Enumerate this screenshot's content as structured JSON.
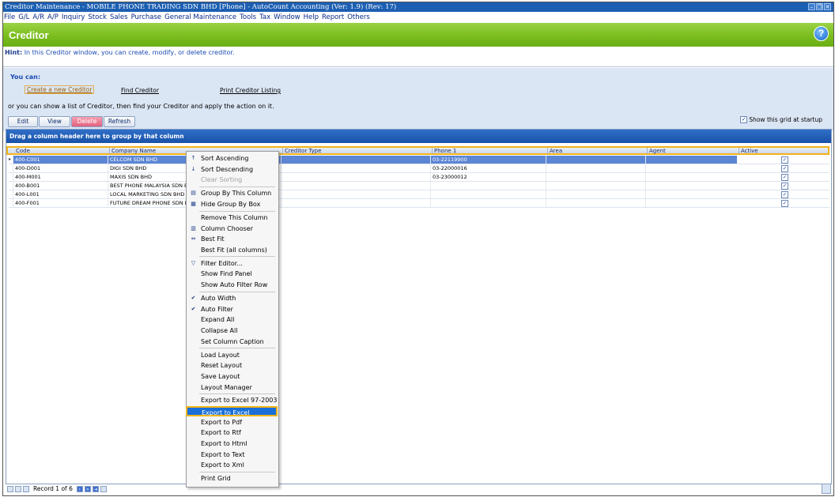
{
  "window": {
    "title": "Creditor Maintenance - MOBILE PHONE TRADING SDN BHD [Phone] - AutoCount Accounting (Ver: 1.9) (Rev: 17)"
  },
  "menu": [
    "File",
    "G/L",
    "A/R",
    "A/P",
    "Inquiry",
    "Stock",
    "Sales",
    "Purchase",
    "General Maintenance",
    "Tools",
    "Tax",
    "Window",
    "Help",
    "Report",
    "Others"
  ],
  "banner": {
    "title": "Creditor"
  },
  "hint": {
    "label": "Hint:",
    "text": " In this Creditor window, you can create, modify, or delete creditor."
  },
  "actions": {
    "you_can": "You can:",
    "links": [
      "Create a new Creditor",
      "Find Creditor",
      "Print Creditor Listing"
    ],
    "or_text": "or you can show a list of Creditor, then find your Creditor and apply the action on it.",
    "buttons": [
      "Edit",
      "View",
      "Delete",
      "Refresh"
    ],
    "show_startup": "Show this grid at startup"
  },
  "grid": {
    "group_panel": "Drag a column header here to group by that column",
    "columns": [
      "Code",
      "Company Name",
      "Creditor Type",
      "Phone 1",
      "Area",
      "Agent",
      "Active"
    ],
    "rows": [
      {
        "code": "400-C001",
        "name": "CELCOM SDN BHD",
        "phone": "03-22119900"
      },
      {
        "code": "400-D001",
        "name": "DIGI SDN BHD",
        "phone": "03-22000016"
      },
      {
        "code": "400-M001",
        "name": "MAXIS SDN BHD",
        "phone": "03-23000012"
      },
      {
        "code": "400-B001",
        "name": "BEST PHONE MALAYSIA SDN BHD",
        "phone": ""
      },
      {
        "code": "400-L001",
        "name": "LOCAL MARKETING SDN BHD",
        "phone": ""
      },
      {
        "code": "400-F001",
        "name": "FUTURE DREAM PHONE SDN BHD",
        "phone": ""
      }
    ],
    "record_text": "Record 1 of 6"
  },
  "context_menu": [
    {
      "label": "Sort Ascending",
      "icon": "sort-asc-icon"
    },
    {
      "label": "Sort Descending",
      "icon": "sort-desc-icon"
    },
    {
      "label": "Clear Sorting",
      "disabled": true
    },
    {
      "sep": true
    },
    {
      "label": "Group By This Column",
      "icon": "group-icon"
    },
    {
      "label": "Hide Group By Box",
      "icon": "group-box-icon"
    },
    {
      "sep": true
    },
    {
      "label": "Remove This Column"
    },
    {
      "label": "Column Chooser",
      "icon": "column-chooser-icon"
    },
    {
      "label": "Best Fit",
      "icon": "best-fit-icon"
    },
    {
      "label": "Best Fit (all columns)"
    },
    {
      "sep": true
    },
    {
      "label": "Filter Editor...",
      "icon": "filter-icon"
    },
    {
      "label": "Show Find Panel"
    },
    {
      "label": "Show Auto Filter Row"
    },
    {
      "sep": true
    },
    {
      "label": "Auto Width",
      "checked": true
    },
    {
      "label": "Auto Filter",
      "checked": true
    },
    {
      "label": "Expand All"
    },
    {
      "label": "Collapse All"
    },
    {
      "label": "Set Column Caption"
    },
    {
      "sep": true
    },
    {
      "label": "Load Layout"
    },
    {
      "label": "Reset Layout"
    },
    {
      "label": "Save Layout"
    },
    {
      "label": "Layout Manager"
    },
    {
      "sep": true
    },
    {
      "label": "Export to Excel 97-2003"
    },
    {
      "label": "Export to Excel",
      "highlighted": true
    },
    {
      "label": "Export to Pdf"
    },
    {
      "label": "Export to Rtf"
    },
    {
      "label": "Export to Html"
    },
    {
      "label": "Export to Text"
    },
    {
      "label": "Export to Xml"
    },
    {
      "sep": true
    },
    {
      "label": "Print Grid"
    }
  ]
}
